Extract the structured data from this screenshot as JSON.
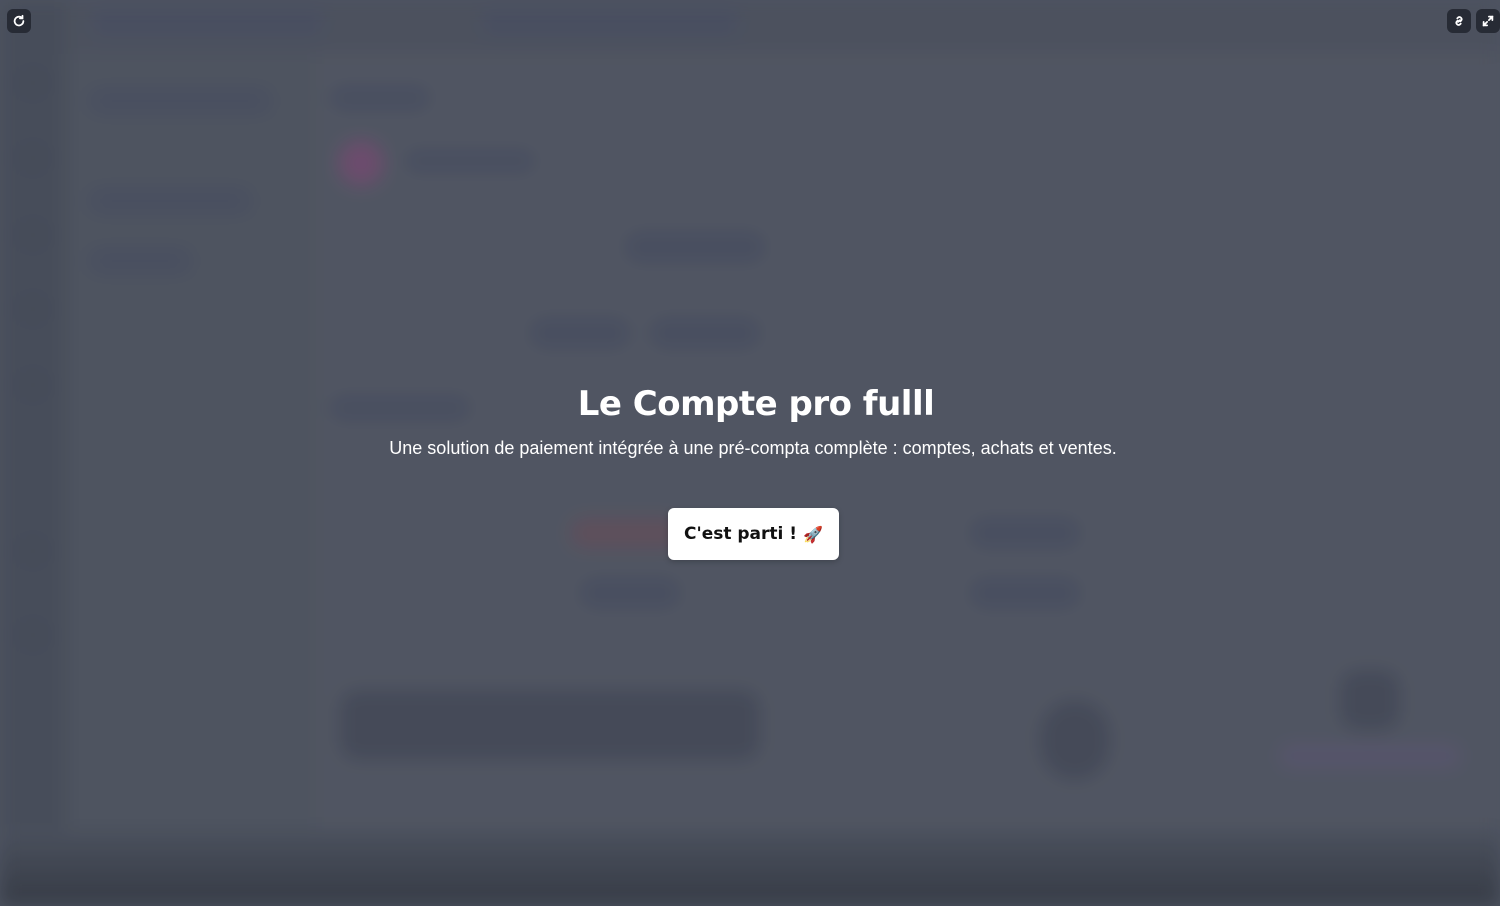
{
  "modal": {
    "title": "Le Compte pro fulll",
    "subtitle": "Une solution de paiement intégrée à une pré-compta complète : comptes, achats et ventes.",
    "cta_label": "C'est parti !",
    "cta_icon": "rocket-icon"
  },
  "toolbar": {
    "refresh_icon": "refresh-icon",
    "link_icon": "link-icon",
    "expand_icon": "expand-icon"
  },
  "colors": {
    "background": "#575d6b",
    "button_bg": "#ffffff",
    "text": "#ffffff"
  }
}
